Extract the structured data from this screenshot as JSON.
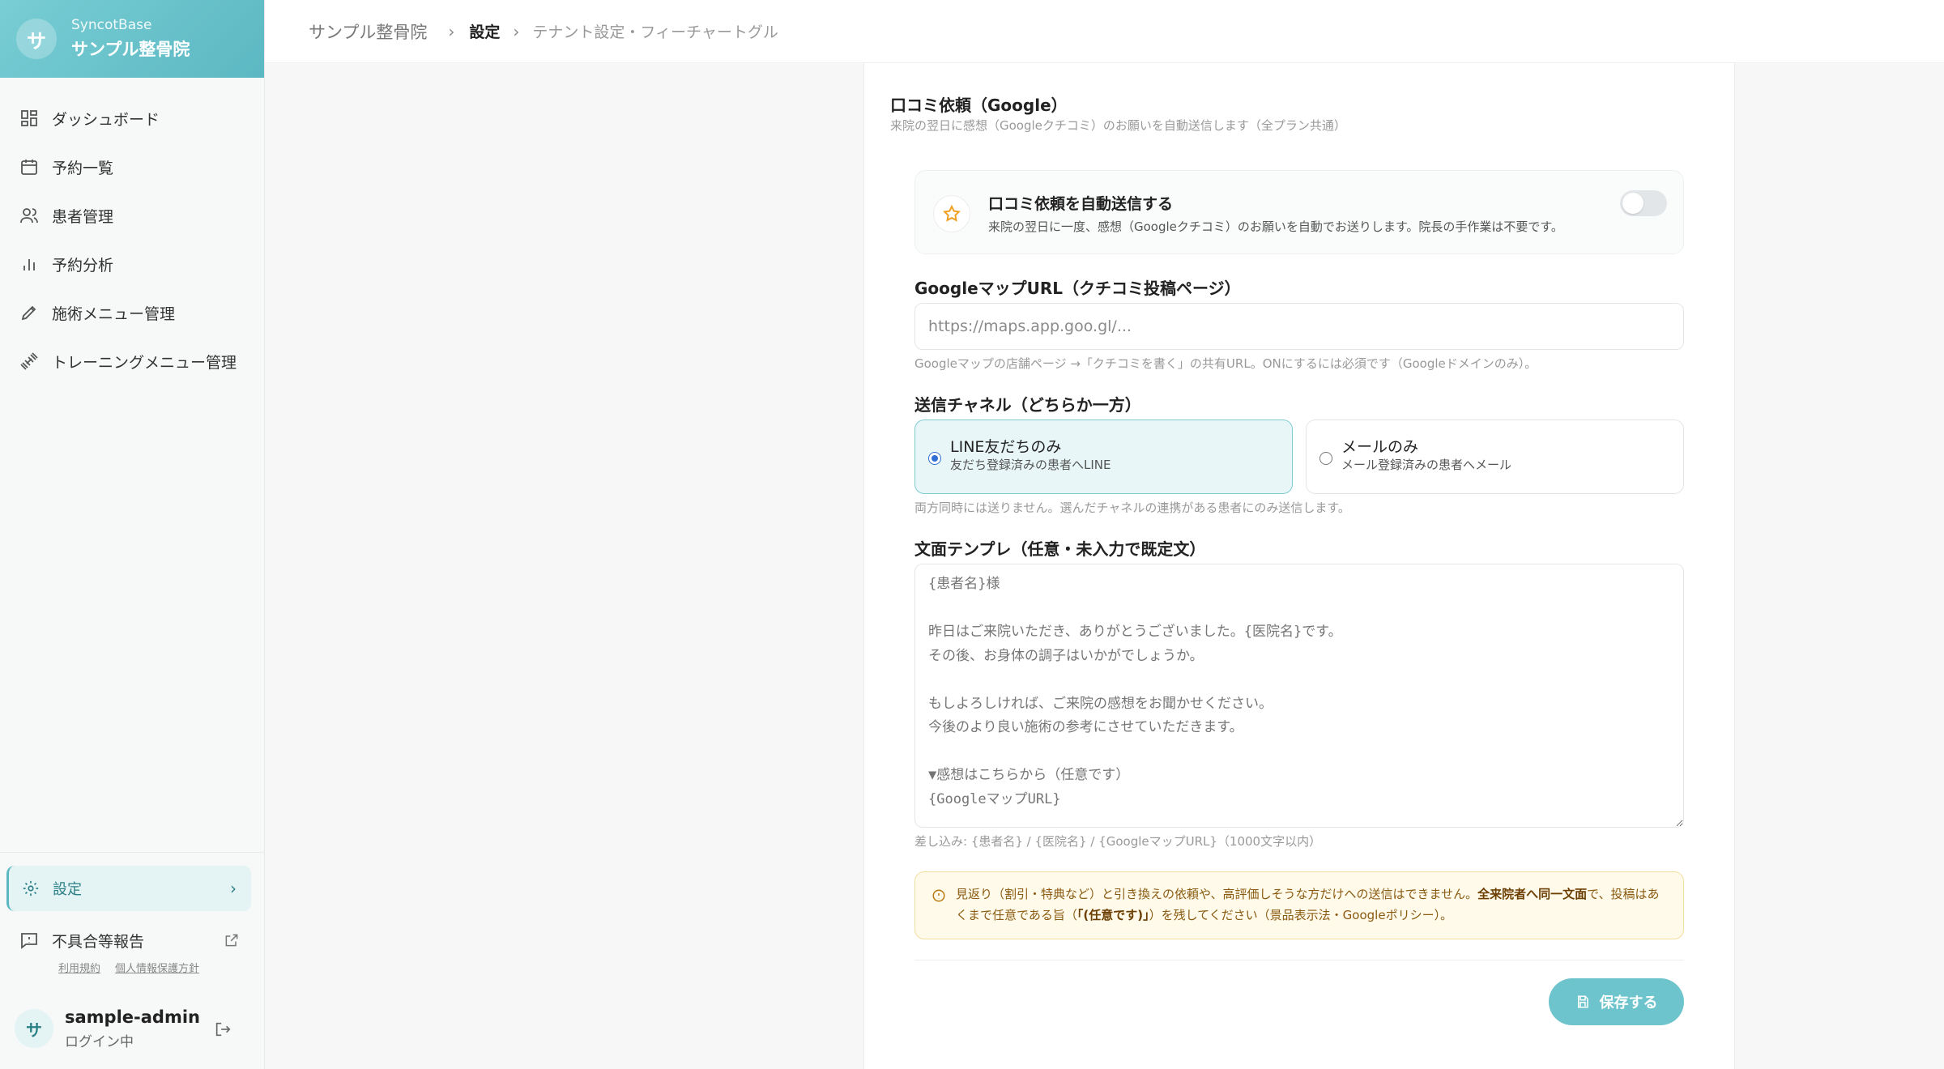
{
  "sidebar": {
    "brand": {
      "avatar": "サ",
      "app_name": "SyncotBase",
      "clinic_name": "サンプル整骨院"
    },
    "nav_items": [
      {
        "label": "ダッシュボード",
        "icon": "dashboard-icon"
      },
      {
        "label": "予約一覧",
        "icon": "calendar-icon"
      },
      {
        "label": "患者管理",
        "icon": "users-icon"
      },
      {
        "label": "予約分析",
        "icon": "bar-chart-icon"
      },
      {
        "label": "施術メニュー管理",
        "icon": "pencil-icon"
      },
      {
        "label": "トレーニングメニュー管理",
        "icon": "dumbbell-icon"
      }
    ],
    "settings": {
      "label": "設定",
      "chevron": "›"
    },
    "report": {
      "label": "不具合等報告"
    },
    "legal": {
      "terms": "利用規約",
      "privacy": "個人情報保護方針"
    },
    "user": {
      "avatar": "サ",
      "name": "sample-admin",
      "status": "ログイン中"
    }
  },
  "header": {
    "breadcrumb": {
      "clinic": "サンプル整骨院",
      "sep": "›",
      "current": "設定",
      "sub": "テナント設定・フィーチャートグル"
    }
  },
  "main": {
    "section_title": "口コミ依頼（Google）",
    "section_desc": "来院の翌日に感想（Googleクチコミ）のお願いを自動送信します（全プラン共通）",
    "auto_send": {
      "title": "口コミ依頼を自動送信する",
      "desc": "来院の翌日に一度、感想（Googleクチコミ）のお願いを自動でお送りします。院長の手作業は不要です。",
      "enabled": false
    },
    "maps_url": {
      "label": "GoogleマップURL（クチコミ投稿ページ）",
      "value": "",
      "placeholder": "https://maps.app.goo.gl/...",
      "hint": "Googleマップの店舗ページ →「クチコミを書く」の共有URL。ONにするには必須です（Googleドメインのみ）。"
    },
    "channel": {
      "label": "送信チャネル（どちらか一方）",
      "options": [
        {
          "title": "LINE友だちのみ",
          "sub": "友だち登録済みの患者へLINE",
          "selected": true
        },
        {
          "title": "メールのみ",
          "sub": "メール登録済みの患者へメール",
          "selected": false
        }
      ],
      "hint": "両方同時には送りません。選んだチャネルの連携がある患者にのみ送信します。"
    },
    "template": {
      "label": "文面テンプレ（任意・未入力で既定文）",
      "placeholder": "{患者名}様\n\n昨日はご来院いただき、ありがとうございました。{医院名}です。\nその後、お身体の調子はいかがでしょうか。\n\nもしよろしければ、ご来院の感想をお聞かせください。\n今後のより良い施術の参考にさせていただきます。\n\n▼感想はこちらから（任意です）\n{GoogleマップURL}",
      "hint": "差し込み: {患者名} / {医院名} / {GoogleマップURL}（1000文字以内）"
    },
    "notice": {
      "text1": "見返り（割引・特典など）と引き換えの依頼や、高評価しそうな方だけへの送信はできません。",
      "bold1": "全来院者へ同一文面",
      "text2": "で、投稿はあくまで任意である旨（",
      "bold2": "「(任意です)」",
      "text3": "）を残してください（景品表示法・Googleポリシー）。"
    },
    "save_label": "保存する"
  }
}
